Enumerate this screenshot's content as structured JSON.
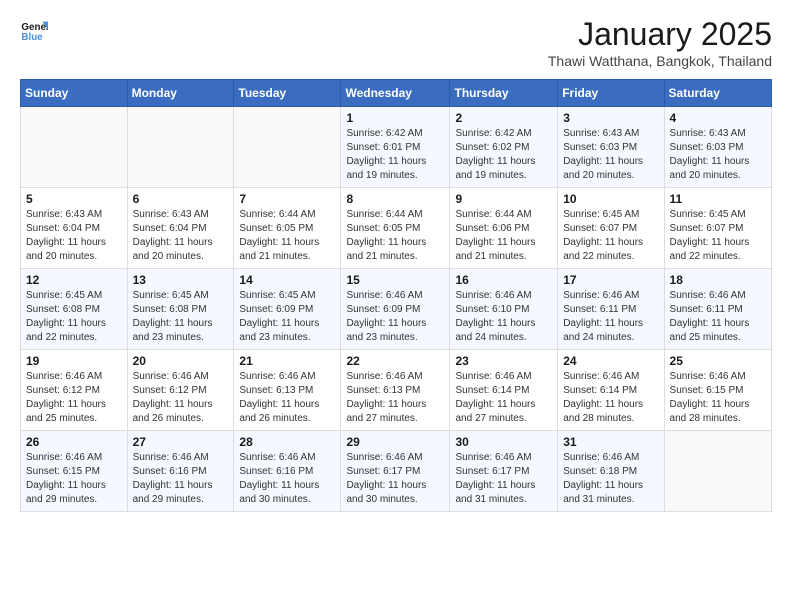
{
  "logo": {
    "line1": "General",
    "line2": "Blue"
  },
  "title": "January 2025",
  "subtitle": "Thawi Watthana, Bangkok, Thailand",
  "days_of_week": [
    "Sunday",
    "Monday",
    "Tuesday",
    "Wednesday",
    "Thursday",
    "Friday",
    "Saturday"
  ],
  "weeks": [
    [
      {
        "day": "",
        "info": ""
      },
      {
        "day": "",
        "info": ""
      },
      {
        "day": "",
        "info": ""
      },
      {
        "day": "1",
        "info": "Sunrise: 6:42 AM\nSunset: 6:01 PM\nDaylight: 11 hours and 19 minutes."
      },
      {
        "day": "2",
        "info": "Sunrise: 6:42 AM\nSunset: 6:02 PM\nDaylight: 11 hours and 19 minutes."
      },
      {
        "day": "3",
        "info": "Sunrise: 6:43 AM\nSunset: 6:03 PM\nDaylight: 11 hours and 20 minutes."
      },
      {
        "day": "4",
        "info": "Sunrise: 6:43 AM\nSunset: 6:03 PM\nDaylight: 11 hours and 20 minutes."
      }
    ],
    [
      {
        "day": "5",
        "info": "Sunrise: 6:43 AM\nSunset: 6:04 PM\nDaylight: 11 hours and 20 minutes."
      },
      {
        "day": "6",
        "info": "Sunrise: 6:43 AM\nSunset: 6:04 PM\nDaylight: 11 hours and 20 minutes."
      },
      {
        "day": "7",
        "info": "Sunrise: 6:44 AM\nSunset: 6:05 PM\nDaylight: 11 hours and 21 minutes."
      },
      {
        "day": "8",
        "info": "Sunrise: 6:44 AM\nSunset: 6:05 PM\nDaylight: 11 hours and 21 minutes."
      },
      {
        "day": "9",
        "info": "Sunrise: 6:44 AM\nSunset: 6:06 PM\nDaylight: 11 hours and 21 minutes."
      },
      {
        "day": "10",
        "info": "Sunrise: 6:45 AM\nSunset: 6:07 PM\nDaylight: 11 hours and 22 minutes."
      },
      {
        "day": "11",
        "info": "Sunrise: 6:45 AM\nSunset: 6:07 PM\nDaylight: 11 hours and 22 minutes."
      }
    ],
    [
      {
        "day": "12",
        "info": "Sunrise: 6:45 AM\nSunset: 6:08 PM\nDaylight: 11 hours and 22 minutes."
      },
      {
        "day": "13",
        "info": "Sunrise: 6:45 AM\nSunset: 6:08 PM\nDaylight: 11 hours and 23 minutes."
      },
      {
        "day": "14",
        "info": "Sunrise: 6:45 AM\nSunset: 6:09 PM\nDaylight: 11 hours and 23 minutes."
      },
      {
        "day": "15",
        "info": "Sunrise: 6:46 AM\nSunset: 6:09 PM\nDaylight: 11 hours and 23 minutes."
      },
      {
        "day": "16",
        "info": "Sunrise: 6:46 AM\nSunset: 6:10 PM\nDaylight: 11 hours and 24 minutes."
      },
      {
        "day": "17",
        "info": "Sunrise: 6:46 AM\nSunset: 6:11 PM\nDaylight: 11 hours and 24 minutes."
      },
      {
        "day": "18",
        "info": "Sunrise: 6:46 AM\nSunset: 6:11 PM\nDaylight: 11 hours and 25 minutes."
      }
    ],
    [
      {
        "day": "19",
        "info": "Sunrise: 6:46 AM\nSunset: 6:12 PM\nDaylight: 11 hours and 25 minutes."
      },
      {
        "day": "20",
        "info": "Sunrise: 6:46 AM\nSunset: 6:12 PM\nDaylight: 11 hours and 26 minutes."
      },
      {
        "day": "21",
        "info": "Sunrise: 6:46 AM\nSunset: 6:13 PM\nDaylight: 11 hours and 26 minutes."
      },
      {
        "day": "22",
        "info": "Sunrise: 6:46 AM\nSunset: 6:13 PM\nDaylight: 11 hours and 27 minutes."
      },
      {
        "day": "23",
        "info": "Sunrise: 6:46 AM\nSunset: 6:14 PM\nDaylight: 11 hours and 27 minutes."
      },
      {
        "day": "24",
        "info": "Sunrise: 6:46 AM\nSunset: 6:14 PM\nDaylight: 11 hours and 28 minutes."
      },
      {
        "day": "25",
        "info": "Sunrise: 6:46 AM\nSunset: 6:15 PM\nDaylight: 11 hours and 28 minutes."
      }
    ],
    [
      {
        "day": "26",
        "info": "Sunrise: 6:46 AM\nSunset: 6:15 PM\nDaylight: 11 hours and 29 minutes."
      },
      {
        "day": "27",
        "info": "Sunrise: 6:46 AM\nSunset: 6:16 PM\nDaylight: 11 hours and 29 minutes."
      },
      {
        "day": "28",
        "info": "Sunrise: 6:46 AM\nSunset: 6:16 PM\nDaylight: 11 hours and 30 minutes."
      },
      {
        "day": "29",
        "info": "Sunrise: 6:46 AM\nSunset: 6:17 PM\nDaylight: 11 hours and 30 minutes."
      },
      {
        "day": "30",
        "info": "Sunrise: 6:46 AM\nSunset: 6:17 PM\nDaylight: 11 hours and 31 minutes."
      },
      {
        "day": "31",
        "info": "Sunrise: 6:46 AM\nSunset: 6:18 PM\nDaylight: 11 hours and 31 minutes."
      },
      {
        "day": "",
        "info": ""
      }
    ]
  ]
}
